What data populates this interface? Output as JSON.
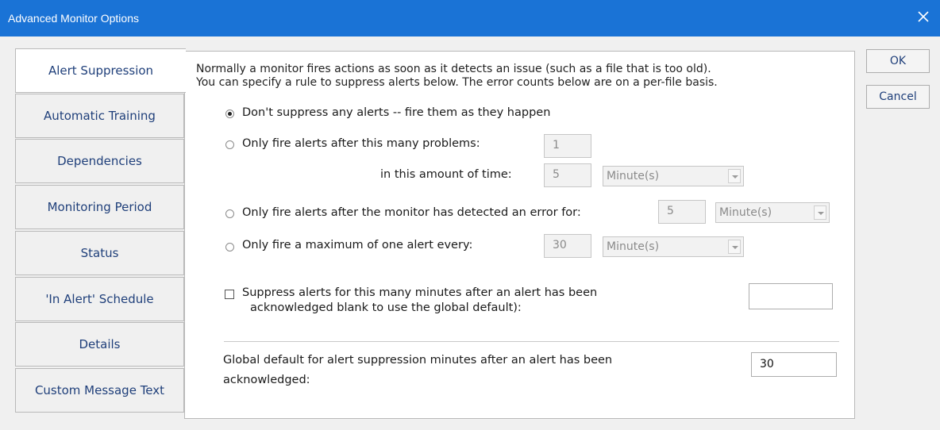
{
  "window": {
    "title": "Advanced Monitor Options",
    "close_icon": "close-icon"
  },
  "tabs": [
    {
      "label": "Alert Suppression",
      "active": true
    },
    {
      "label": "Automatic Training"
    },
    {
      "label": "Dependencies"
    },
    {
      "label": "Monitoring Period"
    },
    {
      "label": "Status"
    },
    {
      "label": "'In Alert' Schedule"
    },
    {
      "label": "Details"
    },
    {
      "label": "Custom Message Text"
    }
  ],
  "buttons": {
    "ok": "OK",
    "cancel": "Cancel"
  },
  "description": {
    "line1": "Normally a monitor fires actions as soon as it detects an issue (such as a file that is too old).",
    "line2": "You can specify a rule to suppress  alerts below.  The error counts below are on a per-file basis."
  },
  "options": {
    "none": {
      "label": "Don't suppress any alerts -- fire them as they happen",
      "selected": true
    },
    "after_problems": {
      "label": "Only fire alerts after this many problems:",
      "count": "1",
      "time_label": "in this amount of time:",
      "time": "5",
      "unit": "Minute(s)",
      "selected": false
    },
    "after_duration": {
      "label": "Only fire alerts after the monitor has detected an error for:",
      "value": "5",
      "unit": "Minute(s)",
      "selected": false
    },
    "max_one": {
      "label": "Only fire a maximum of one alert every:",
      "value": "30",
      "unit": "Minute(s)",
      "selected": false
    }
  },
  "suppress_ack": {
    "line1": "Suppress alerts for this many minutes after an alert has been",
    "line2": "acknowledged blank to use the global default):",
    "value": "",
    "checked": false
  },
  "global_default": {
    "line1": "Global default for alert suppression minutes after an alert has been",
    "line2": "acknowledged:",
    "value": "30"
  }
}
